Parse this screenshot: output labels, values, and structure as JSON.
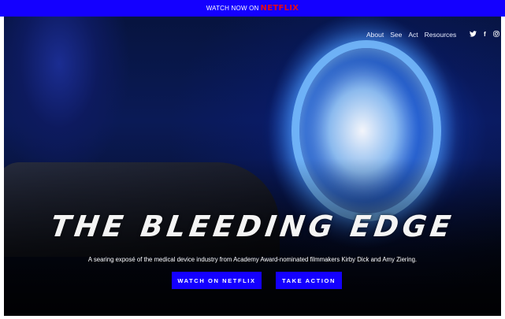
{
  "banner": {
    "text": "WATCH NOW ON",
    "brand": "NETFLIX",
    "background": "#1400ff",
    "brand_color": "#e50914"
  },
  "nav": {
    "items": [
      "About",
      "See",
      "Act",
      "Resources"
    ]
  },
  "social": {
    "icons": [
      "twitter-icon",
      "facebook-icon",
      "instagram-icon"
    ],
    "glyphs": [
      "🐦",
      "f",
      "◎"
    ]
  },
  "hero": {
    "title": "THE BLEEDING EDGE",
    "tagline": "A searing exposé of the medical device industry from Academy Award-nominated filmmakers Kirby Dick and Amy Ziering.",
    "buttons": {
      "watch": "WATCH ON NETFLIX",
      "action": "TAKE ACTION"
    },
    "accent": "#1400ff"
  }
}
